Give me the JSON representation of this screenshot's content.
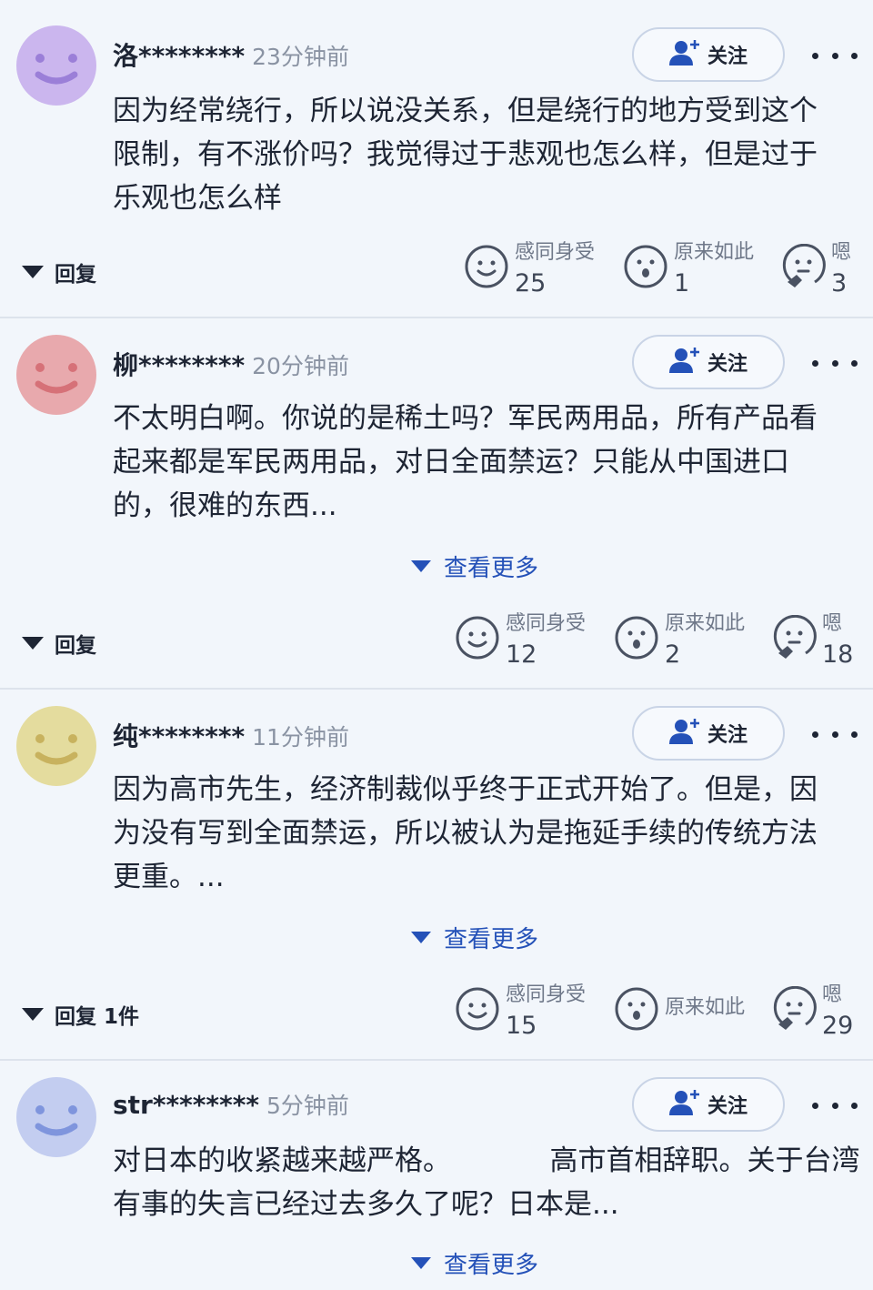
{
  "comments": [
    {
      "username": "洛********",
      "time": "23分钟前",
      "avatar_color": "#cbb6ee",
      "face_color": "#9b7fd8",
      "follow_label": "关注",
      "lines": [
        "因为经常绕行，所以说没关系，但是绕行的地方受到这个",
        "限制，有不涨价吗？我觉得过于悲观也怎么样，但是过于",
        "乐观也怎么样"
      ],
      "reply_label": "回复",
      "reactions": [
        {
          "label": "感同身受",
          "count": "25",
          "icon": "smile-icon"
        },
        {
          "label": "原来如此",
          "count": "1",
          "icon": "surprised-icon"
        },
        {
          "label": "嗯",
          "count": "3",
          "icon": "thinking-icon"
        }
      ]
    },
    {
      "username": "柳********",
      "time": "20分钟前",
      "avatar_color": "#e8a9ad",
      "face_color": "#d67178",
      "follow_label": "关注",
      "lines": [
        "不太明白啊。你说的是稀土吗？军民两用品，所有产品看",
        "起来都是军民两用品，对日全面禁运？只能从中国进口",
        "的，很难的东西..."
      ],
      "see_more_label": "查看更多",
      "reply_label": "回复",
      "reactions": [
        {
          "label": "感同身受",
          "count": "12",
          "icon": "smile-icon"
        },
        {
          "label": "原来如此",
          "count": "2",
          "icon": "surprised-icon"
        },
        {
          "label": "嗯",
          "count": "18",
          "icon": "thinking-icon"
        }
      ]
    },
    {
      "username": "纯********",
      "time": "11分钟前",
      "avatar_color": "#e4dc9e",
      "face_color": "#c8b25e",
      "follow_label": "关注",
      "lines": [
        "因为高市先生，经济制裁似乎终于正式开始了。但是，因",
        "为没有写到全面禁运，所以被认为是拖延手续的传统方法",
        "更重。..."
      ],
      "see_more_label": "查看更多",
      "reply_label": "回复 1件",
      "reactions": [
        {
          "label": "感同身受",
          "count": "15",
          "icon": "smile-icon"
        },
        {
          "label": "原来如此",
          "count": "",
          "icon": "surprised-icon"
        },
        {
          "label": "嗯",
          "count": "29",
          "icon": "thinking-icon"
        }
      ]
    },
    {
      "username": "str********",
      "time": "5分钟前",
      "avatar_color": "#c3cdf0",
      "face_color": "#7f95dd",
      "follow_label": "关注",
      "lines": [
        "对日本的收紧越来越严格。　　　　高市首相辞职。关于台湾",
        "有事的失言已经过去多久了呢？日本是..."
      ],
      "see_more_label": "查看更多"
    }
  ],
  "colors": {
    "background": "#f2f6fb",
    "link": "#2451b8",
    "divider": "#dde3ec"
  }
}
